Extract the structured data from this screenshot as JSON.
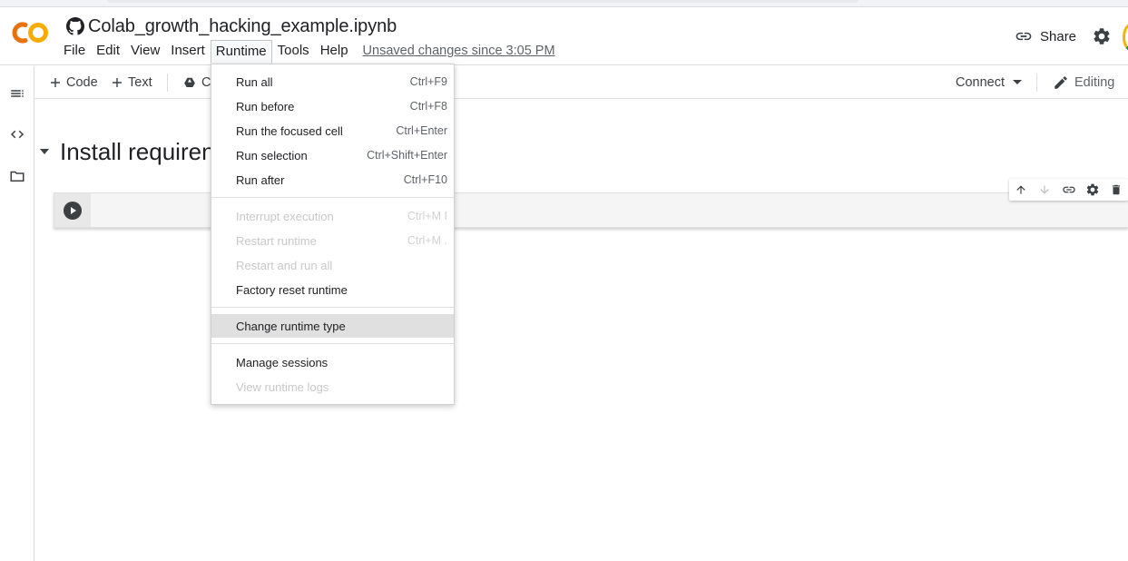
{
  "notebook": {
    "title": "Colab_growth_hacking_example.ipynb"
  },
  "menubar": {
    "items": [
      "File",
      "Edit",
      "View",
      "Insert",
      "Runtime",
      "Tools",
      "Help"
    ],
    "active": "Runtime",
    "unsaved": "Unsaved changes since 3:05 PM"
  },
  "header": {
    "share_label": "Share"
  },
  "toolbar": {
    "code_label": "Code",
    "text_label": "Text",
    "copy_partial": "C",
    "connect_label": "Connect",
    "editing_label": "Editing"
  },
  "content": {
    "section_title": "Install requiren"
  },
  "runtime_menu": {
    "groups": [
      [
        {
          "label": "Run all",
          "shortcut": "Ctrl+F9",
          "disabled": false
        },
        {
          "label": "Run before",
          "shortcut": "Ctrl+F8",
          "disabled": false
        },
        {
          "label": "Run the focused cell",
          "shortcut": "Ctrl+Enter",
          "disabled": false
        },
        {
          "label": "Run selection",
          "shortcut": "Ctrl+Shift+Enter",
          "disabled": false
        },
        {
          "label": "Run after",
          "shortcut": "Ctrl+F10",
          "disabled": false
        }
      ],
      [
        {
          "label": "Interrupt execution",
          "shortcut": "Ctrl+M I",
          "disabled": true
        },
        {
          "label": "Restart runtime",
          "shortcut": "Ctrl+M .",
          "disabled": true
        },
        {
          "label": "Restart and run all",
          "shortcut": "",
          "disabled": true
        },
        {
          "label": "Factory reset runtime",
          "shortcut": "",
          "disabled": false
        }
      ],
      [
        {
          "label": "Change runtime type",
          "shortcut": "",
          "disabled": false,
          "highlighted": true
        }
      ],
      [
        {
          "label": "Manage sessions",
          "shortcut": "",
          "disabled": false
        },
        {
          "label": "View runtime logs",
          "shortcut": "",
          "disabled": true
        }
      ]
    ]
  },
  "colors": {
    "logo_orange": "#f9ab00",
    "logo_yellow": "#e8710a",
    "menu_highlight": "#e0e0e0",
    "disabled_text": "#c8c8c8"
  }
}
